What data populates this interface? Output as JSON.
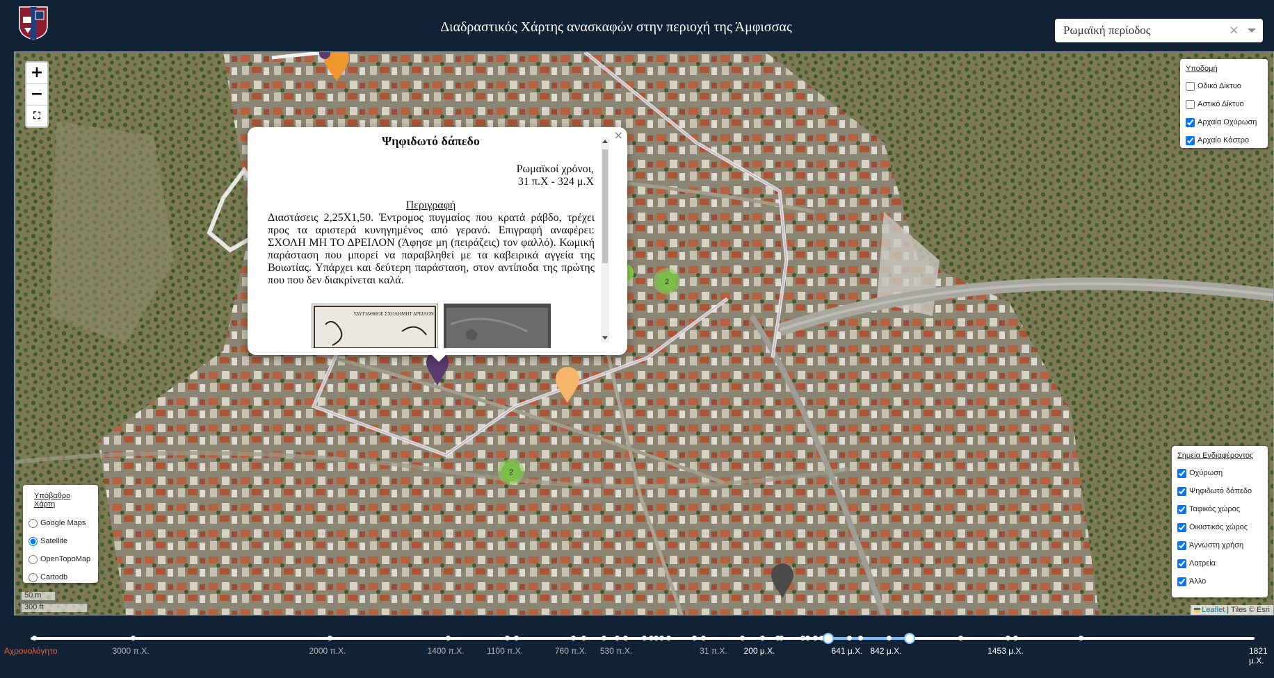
{
  "header": {
    "title": "Διαδραστικός Χάρτης ανασκαφών στην περιοχή της Άμφισσας",
    "period_select": {
      "value": "Ρωμαϊκή περίοδος",
      "clear": "×"
    }
  },
  "zoom": {
    "in": "+",
    "out": "−",
    "fullscreen": "⛶"
  },
  "infrastructure_panel": {
    "title": "Υποδομή",
    "items": [
      {
        "label": "Οδικό Δίκτυο",
        "checked": false
      },
      {
        "label": "Αστικό Δίκτυο",
        "checked": false
      },
      {
        "label": "Αρχαία Οχύρωση",
        "checked": true
      },
      {
        "label": "Αρχαίο Κάστρο",
        "checked": true
      }
    ]
  },
  "poi_panel": {
    "title": "Σημεία Ενδιαφέροντος",
    "items": [
      {
        "label": "Οχύρωση",
        "checked": true
      },
      {
        "label": "Ψηφιδωτό δάπεδο",
        "checked": true
      },
      {
        "label": "Ταφικός χώρος",
        "checked": true
      },
      {
        "label": "Οικιστικός χώρος",
        "checked": true
      },
      {
        "label": "Άγνωστη χρήση",
        "checked": true
      },
      {
        "label": "Λατρεία",
        "checked": true
      },
      {
        "label": "Άλλο",
        "checked": true
      }
    ]
  },
  "basemap_panel": {
    "title": "Υπόβαθρο Χάρτη",
    "items": [
      {
        "label": "Google Maps",
        "checked": false
      },
      {
        "label": "Satellite",
        "checked": true
      },
      {
        "label": "OpenTopoMap",
        "checked": false
      },
      {
        "label": "Cartodb",
        "checked": false
      }
    ]
  },
  "popup": {
    "title": "Ψηφιδωτό δάπεδο",
    "period_line1": "Ρωμαϊκοί χρόνοι,",
    "period_line2": "31 π.Χ - 324 μ.Χ",
    "description_heading": "Περιγραφή",
    "description": "Διαστάσεις 2,25Χ1,50. Έντρομος πυγμαίος που κρατά ράβδο, τρέχει προς τα αριστερά κυνηγημένος από γερανό. Επιγραφή αναφέρει: ΣΧΟΛΗ ΜΗ ΤΟ ΔΡΕΙΛΟΝ (Άφησε μη (πειράζεις) τον φαλλό). Κωμική παράσταση που μπορεί να παραβληθεί με τα καβειρικά αγγεία της Βοιωτίας. Υπάρχει και δεύτερη παράσταση, στον αντίποδα της πρώτης που που δεν διακρίνεται καλά.",
    "image1_inscription": "ΥΔΥΓΙΔΘΗΟΕ ΣΧΟΛΗΜΗΤ ΔΡΕΙΛΟΝ",
    "close": "×"
  },
  "clusters": [
    {
      "count": "2"
    },
    {
      "count": "2"
    }
  ],
  "scale": {
    "metric": "50 m",
    "imperial": "300 ft"
  },
  "attribution": {
    "leaflet": "Leaflet",
    "tiles": " | Tiles © Esri"
  },
  "timeline": {
    "undated_label": "Αχρονολόγητο",
    "labels": [
      {
        "text": "3000 π.Χ.",
        "active": false
      },
      {
        "text": "2000 π.Χ.",
        "active": false
      },
      {
        "text": "1400 π.Χ.",
        "active": false
      },
      {
        "text": "1100 π.Χ.",
        "active": false
      },
      {
        "text": "760 π.Χ.",
        "active": false
      },
      {
        "text": "530 π.Χ.",
        "active": false
      },
      {
        "text": "31 π.Χ.",
        "active": false
      },
      {
        "text": "200 μ.Χ.",
        "active": true
      },
      {
        "text": "641 μ.Χ.",
        "active": true
      },
      {
        "text": "842 μ.Χ.",
        "active": true
      },
      {
        "text": "1453 μ.Χ.",
        "active": true
      },
      {
        "text": "1821 μ.Χ.",
        "active": true
      }
    ]
  },
  "colors": {
    "header_bg": "#122235",
    "marker_orange": "#f0962f",
    "marker_purple": "#5b3a6e",
    "marker_gray": "#4a4a4a",
    "cluster_green": "#8ccc55",
    "timeline_selection": "#79c3ff",
    "undated_red": "#e8603a"
  }
}
